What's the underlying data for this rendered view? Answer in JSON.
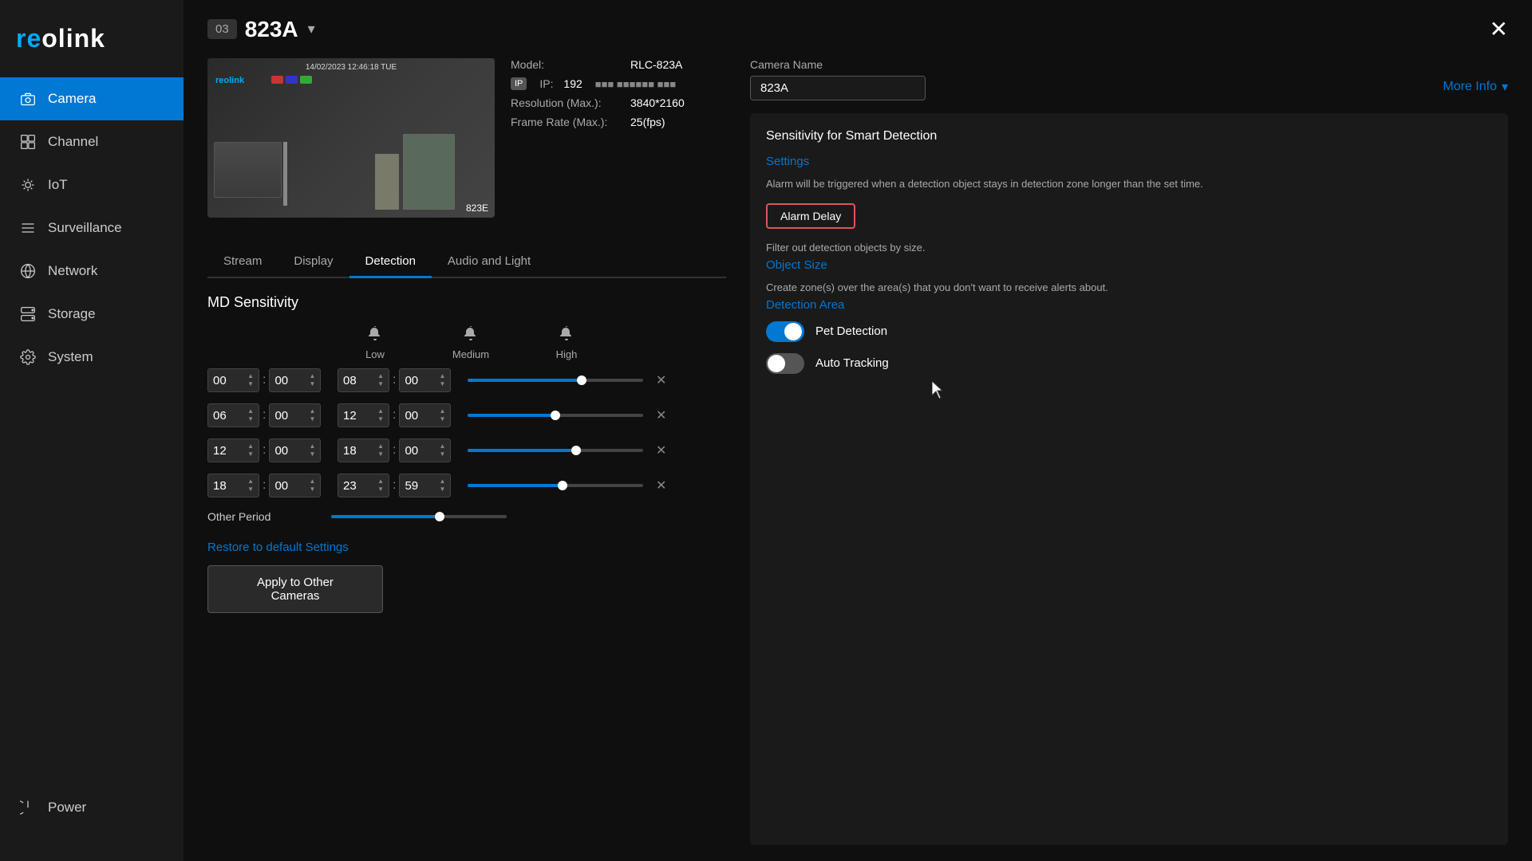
{
  "app": {
    "title": "Reolink",
    "close_label": "✕"
  },
  "sidebar": {
    "logo": "reolink",
    "items": [
      {
        "id": "camera",
        "label": "Camera",
        "active": true
      },
      {
        "id": "channel",
        "label": "Channel",
        "active": false
      },
      {
        "id": "iot",
        "label": "IoT",
        "active": false
      },
      {
        "id": "surveillance",
        "label": "Surveillance",
        "active": false
      },
      {
        "id": "network",
        "label": "Network",
        "active": false
      },
      {
        "id": "storage",
        "label": "Storage",
        "active": false
      },
      {
        "id": "system",
        "label": "System",
        "active": false
      }
    ],
    "power_label": "Power"
  },
  "camera_header": {
    "number": "03",
    "name": "823A",
    "dropdown": "▾",
    "close": "✕"
  },
  "camera_info": {
    "name_label": "Camera Name",
    "name_value": "823A",
    "more_info_label": "More Info",
    "model_label": "Model:",
    "model_value": "RLC-823A",
    "ip_label": "IP:",
    "ip_value": "192",
    "ip_masked": "■■■ ■■■■■■ ■■■",
    "resolution_label": "Resolution (Max.):",
    "resolution_value": "3840*2160",
    "framerate_label": "Frame Rate (Max.):",
    "framerate_value": "25(fps)"
  },
  "tabs": [
    {
      "id": "stream",
      "label": "Stream",
      "active": false
    },
    {
      "id": "display",
      "label": "Display",
      "active": false
    },
    {
      "id": "detection",
      "label": "Detection",
      "active": true
    },
    {
      "id": "audio_light",
      "label": "Audio and Light",
      "active": false
    }
  ],
  "detection": {
    "md_sensitivity_title": "MD Sensitivity",
    "sensitivity_levels": {
      "low_label": "Low",
      "medium_label": "Medium",
      "high_label": "High"
    },
    "slider_rows": [
      {
        "start_h": "00",
        "start_m": "00",
        "end_h": "08",
        "end_m": "00",
        "fill_pct": 65
      },
      {
        "start_h": "06",
        "start_m": "00",
        "end_h": "12",
        "end_m": "00",
        "fill_pct": 50
      },
      {
        "start_h": "12",
        "start_m": "00",
        "end_h": "18",
        "end_m": "00",
        "fill_pct": 62
      },
      {
        "start_h": "18",
        "start_m": "00",
        "end_h": "23",
        "end_m": "59",
        "fill_pct": 54
      }
    ],
    "other_period_label": "Other Period",
    "other_period_fill_pct": 62,
    "restore_label": "Restore to default Settings",
    "apply_btn_label": "Apply to Other Cameras",
    "smart_detection_title": "Sensitivity for Smart Detection",
    "settings_label": "Settings",
    "settings_desc": "Alarm will be triggered when a detection object stays in detection zone longer than the set time.",
    "alarm_delay_label": "Alarm Delay",
    "object_size_desc": "Filter out detection objects by size.",
    "object_size_label": "Object Size",
    "detection_area_desc": "Create zone(s) over the area(s) that you don't want to receive alerts about.",
    "detection_area_label": "Detection Area",
    "pet_detection_label": "Pet Detection",
    "pet_detection_on": true,
    "auto_tracking_label": "Auto Tracking",
    "auto_tracking_on": false
  }
}
